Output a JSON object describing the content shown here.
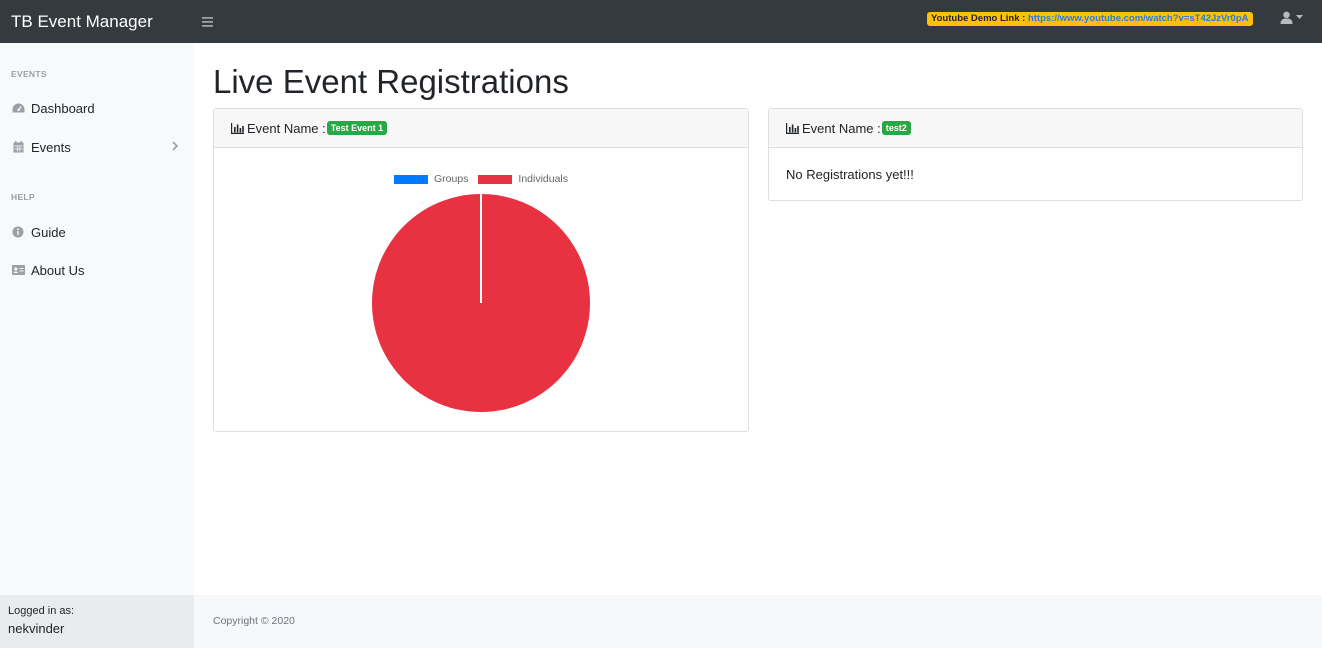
{
  "app": {
    "brand": "TB Event Manager"
  },
  "header": {
    "demo_label": "Youtube Demo Link : ",
    "demo_url": "https://www.youtube.com/watch?v=sT42JzVr0pA",
    "toggle_icon": "bars-icon",
    "user_icon": "user-icon"
  },
  "sidebar": {
    "section_events": "EVENTS",
    "section_help": "HELP",
    "items": [
      {
        "label": "Dashboard",
        "icon": "tachometer-icon"
      },
      {
        "label": "Events",
        "icon": "calendar-icon"
      },
      {
        "label": "Guide",
        "icon": "info-circle-icon"
      },
      {
        "label": "About Us",
        "icon": "id-card-icon"
      }
    ],
    "logged_in_label": "Logged in as:",
    "username": "nekvinder"
  },
  "main": {
    "title": "Live Event Registrations",
    "cards": [
      {
        "label": "Event Name :",
        "event": "Test Event 1"
      },
      {
        "label": "Event Name :",
        "event": "test2",
        "message": "No Registrations yet!!!"
      }
    ]
  },
  "colors": {
    "groups": "#007bff",
    "individuals": "#e83241",
    "badge": "#28a745",
    "demo": "#ffc107"
  },
  "chart_data": {
    "type": "pie",
    "categories": [
      "Groups",
      "Individuals"
    ],
    "values": [
      0,
      1
    ],
    "legend": "top"
  },
  "footer": {
    "copyright": "Copyright © 2020"
  }
}
